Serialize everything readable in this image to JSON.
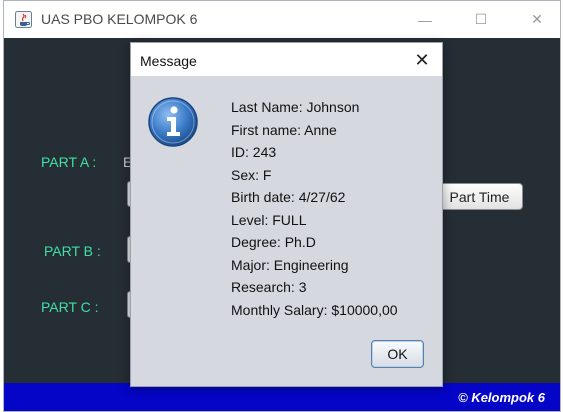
{
  "window": {
    "title": "UAS PBO KELOMPOK 6",
    "minimize_glyph": "—",
    "maximize_glyph": "☐",
    "close_glyph": "✕"
  },
  "form": {
    "part_a_label": "PART A :",
    "part_a_text": "E",
    "part_time_button": "Part Time",
    "part_b_label": "PART B :",
    "part_c_label": "PART C :"
  },
  "footer": {
    "text": "© Kelompok 6"
  },
  "dialog": {
    "title": "Message",
    "close_glyph": "✕",
    "icon": "information-icon",
    "lines": [
      "Last Name: Johnson",
      "First name: Anne",
      "ID: 243",
      "Sex: F",
      "Birth date: 4/27/62",
      "Level: FULL",
      "Degree: Ph.D",
      "Major: Engineering",
      "Research: 3",
      "Monthly Salary: $10000,00"
    ],
    "ok_label": "OK"
  },
  "colors": {
    "content_bg": "#252d35",
    "label_green": "#3fe0a8",
    "footer_blue": "#0505c8",
    "dialog_bg": "#d5d9df",
    "info_blue": "#2f6fb8"
  }
}
